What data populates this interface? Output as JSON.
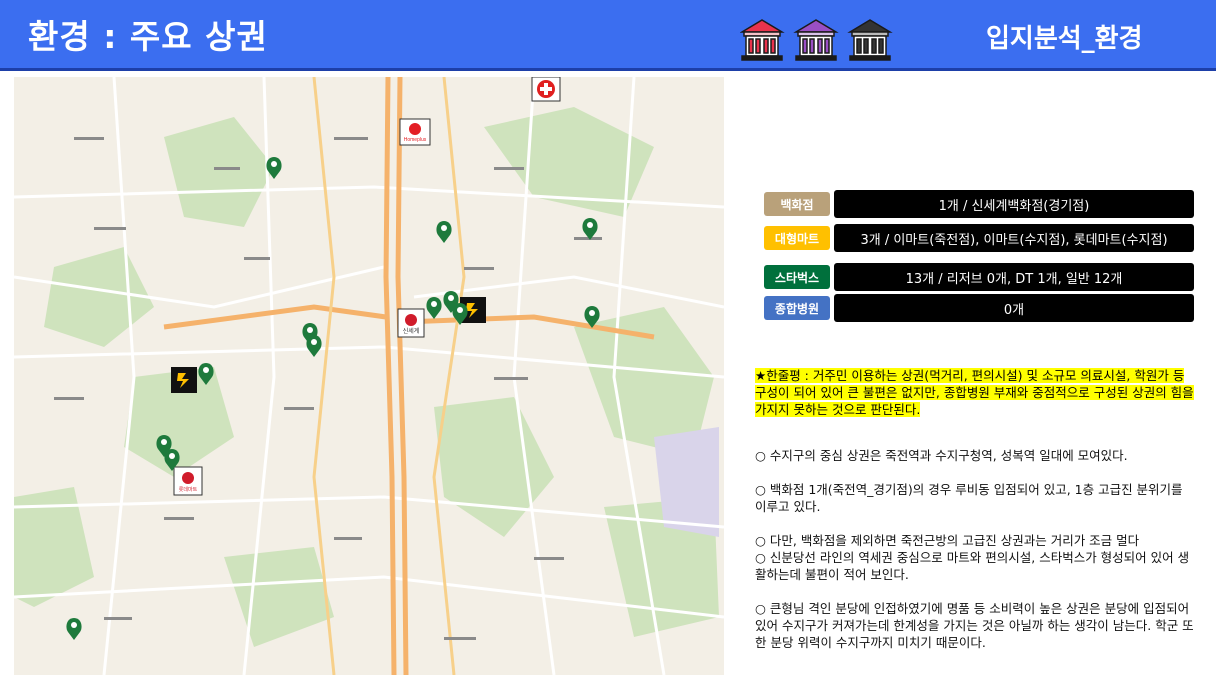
{
  "header": {
    "title": "환경 : 주요 상권",
    "right_title": "입지분석_환경"
  },
  "legend": [
    {
      "category": "백화점",
      "value": "1개 / 신세계백화점(경기점)",
      "tag_bg": "#b9a17a",
      "tag_fg": "#ffffff"
    },
    {
      "category": "대형마트",
      "value": "3개 / 이마트(죽전점), 이마트(수지점), 롯데마트(수지점)",
      "tag_bg": "#ffc000",
      "tag_fg": "#ffffff"
    },
    {
      "category": "스타벅스",
      "value": "13개 / 리저브 0개, DT 1개, 일반 12개",
      "tag_bg": "#00703c",
      "tag_fg": "#ffffff"
    },
    {
      "category": "종합병원",
      "value": "0개",
      "tag_bg": "#4472c4",
      "tag_fg": "#ffffff"
    }
  ],
  "summary": "★한줄평 : 거주민 이용하는 상권(먹거리, 편의시설) 및 소규모 의료시설, 학원가 등 구성이 되어 있어 큰 불편은 없지만, 종합병원 부재와 중점적으로 구성된 상권의 힘을 가지지 못하는 것으로 판단된다.",
  "notes": [
    "○ 수지구의 중심 상권은 죽전역과 수지구청역, 성복역 일대에 모여있다.",
    "○ 백화점 1개(죽전역_경기점)의 경우 루비동 입점되어 있고, 1층 고급진 분위기를 이루고 있다.",
    "○ 다만, 백화점을 제외하면 죽전근방의 고급진 상권과는 거리가 조금 멀다",
    "○ 신분당선 라인의 역세권 중심으로 마트와 편의시설, 스타벅스가 형성되어 있어 생활하는데 불편이 적어 보인다.",
    "○ 큰형님 격인 분당에 인접하였기에 명품 등 소비력이 높은 상권은 분당에 입점되어 있어 수지구가 커져가는데 한계성을 가지는 것은 아닐까 하는 생각이 남는다. 학군 또한 분당 위력이 수지구까지 미치기 때문이다."
  ],
  "map": {
    "markers": {
      "starbucks_color": "#1e7a3c",
      "emart_color": "#ffc000",
      "hospital_color": "#e02020",
      "lotte_color": "#d01c2b"
    },
    "labels": {
      "homeplus": "Homeplus",
      "shinsegae": "신세계",
      "lotte": "롯데마트"
    }
  }
}
